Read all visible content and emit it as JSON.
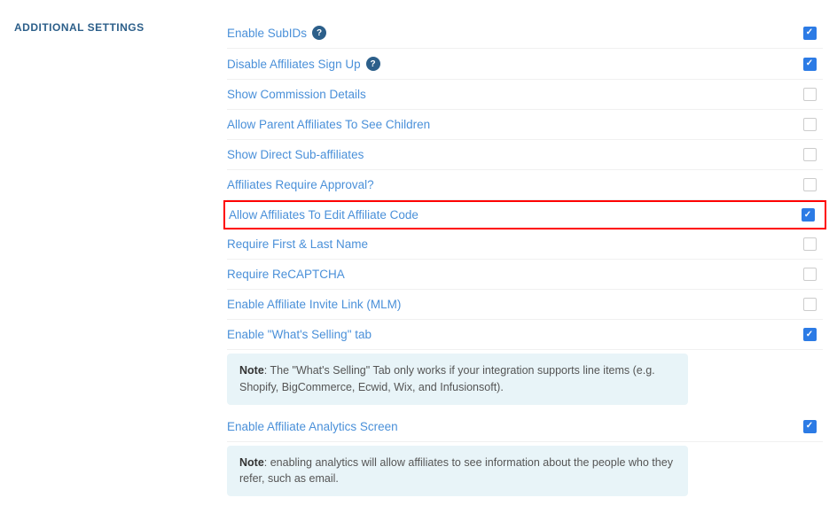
{
  "sidebar": {
    "title": "ADDITIONAL SETTINGS"
  },
  "settings": [
    {
      "id": "enable-subids",
      "label": "Enable SubIDs",
      "hasHelp": true,
      "checked": true,
      "highlighted": false,
      "note": null
    },
    {
      "id": "disable-affiliates-signup",
      "label": "Disable Affiliates Sign Up",
      "hasHelp": true,
      "checked": true,
      "highlighted": false,
      "note": null
    },
    {
      "id": "show-commission-details",
      "label": "Show Commission Details",
      "hasHelp": false,
      "checked": false,
      "highlighted": false,
      "note": null
    },
    {
      "id": "allow-parent-affiliates",
      "label": "Allow Parent Affiliates To See Children",
      "hasHelp": false,
      "checked": false,
      "highlighted": false,
      "note": null
    },
    {
      "id": "show-direct-sub-affiliates",
      "label": "Show Direct Sub-affiliates",
      "hasHelp": false,
      "checked": false,
      "highlighted": false,
      "note": null
    },
    {
      "id": "affiliates-require-approval",
      "label": "Affiliates Require Approval?",
      "hasHelp": false,
      "checked": false,
      "highlighted": false,
      "note": null
    },
    {
      "id": "allow-affiliates-edit-code",
      "label": "Allow Affiliates To Edit Affiliate Code",
      "hasHelp": false,
      "checked": true,
      "highlighted": true,
      "note": null
    },
    {
      "id": "require-first-last-name",
      "label": "Require First & Last Name",
      "hasHelp": false,
      "checked": false,
      "highlighted": false,
      "note": null
    },
    {
      "id": "require-recaptcha",
      "label": "Require ReCAPTCHA",
      "hasHelp": false,
      "checked": false,
      "highlighted": false,
      "note": null
    },
    {
      "id": "enable-affiliate-invite-link",
      "label": "Enable Affiliate Invite Link (MLM)",
      "hasHelp": false,
      "checked": false,
      "highlighted": false,
      "note": null
    },
    {
      "id": "enable-whats-selling-tab",
      "label": "Enable \"What's Selling\" tab",
      "hasHelp": false,
      "checked": true,
      "highlighted": false,
      "note": "Note: The \"What's Selling\" Tab only works if your integration supports line items (e.g. Shopify, BigCommerce, Ecwid, Wix, and Infusionsoft)."
    },
    {
      "id": "enable-affiliate-analytics",
      "label": "Enable Affiliate Analytics Screen",
      "hasHelp": false,
      "checked": true,
      "highlighted": false,
      "note": "Note: enabling analytics will allow affiliates to see information about the people who they refer, such as email."
    }
  ],
  "notes": {
    "whats-selling": "The \"What's Selling\" Tab only works if your integration supports line items (e.g. Shopify, BigCommerce, Ecwid, Wix, and Infusionsoft).",
    "analytics": "enabling analytics will allow affiliates to see information about the people who they refer, such as email."
  }
}
